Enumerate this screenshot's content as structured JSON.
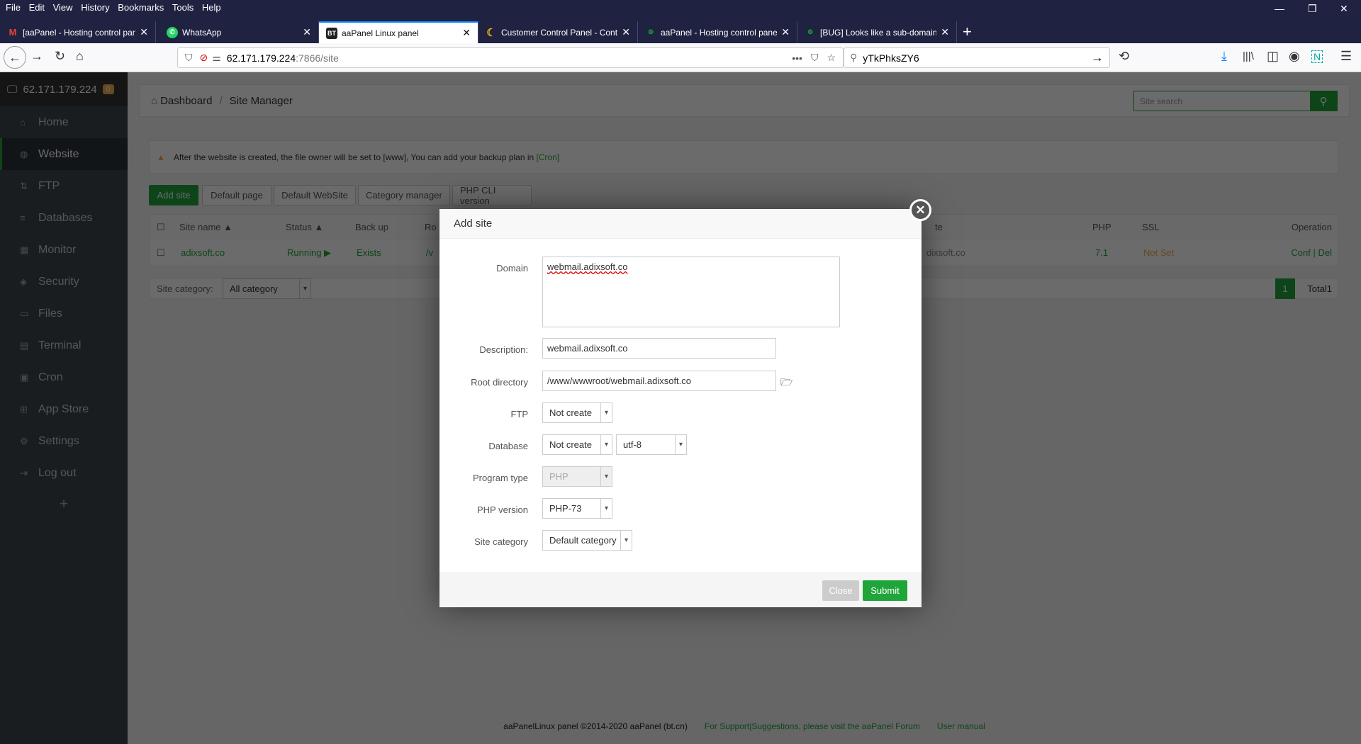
{
  "browser": {
    "menu": [
      "File",
      "Edit",
      "View",
      "History",
      "Bookmarks",
      "Tools",
      "Help"
    ],
    "tabs": [
      {
        "title": "[aaPanel - Hosting control panel",
        "icon": "gmail-icon"
      },
      {
        "title": "WhatsApp",
        "icon": "whatsapp-icon"
      },
      {
        "title": "aaPanel Linux panel",
        "icon": "bt-icon",
        "badge": "BT"
      },
      {
        "title": "Customer Control Panel - Contact",
        "icon": "moon-icon"
      },
      {
        "title": "aaPanel - Hosting control panel",
        "icon": "aapanel-icon"
      },
      {
        "title": "[BUG] Looks like a sub-domain",
        "icon": "aapanel-icon"
      }
    ],
    "url_host": "62.171.179.224",
    "url_rest": ":7866/site",
    "search_value": "yTkPhksZY6"
  },
  "sidebar": {
    "host": "62.171.179.224",
    "badge": "0",
    "items": [
      {
        "label": "Home",
        "icon": "⌂"
      },
      {
        "label": "Website",
        "icon": "◍"
      },
      {
        "label": "FTP",
        "icon": "⇅"
      },
      {
        "label": "Databases",
        "icon": "≡"
      },
      {
        "label": "Monitor",
        "icon": "▦"
      },
      {
        "label": "Security",
        "icon": "◈"
      },
      {
        "label": "Files",
        "icon": "▭"
      },
      {
        "label": "Terminal",
        "icon": "▤"
      },
      {
        "label": "Cron",
        "icon": "▣"
      },
      {
        "label": "App Store",
        "icon": "⊞"
      },
      {
        "label": "Settings",
        "icon": "⚙"
      },
      {
        "label": "Log out",
        "icon": "⇥"
      }
    ],
    "add": "+"
  },
  "breadcrumb": {
    "home": "Dashboard",
    "sep": "/",
    "current": "Site Manager"
  },
  "site_search_placeholder": "Site search",
  "notice": {
    "text": "After the website is created, the file owner will be set to [www], You can add your backup plan in ",
    "link": "[Cron]"
  },
  "toolbar": [
    "Add site",
    "Default page",
    "Default WebSite",
    "Category manager",
    "PHP CLI version"
  ],
  "table": {
    "headers": {
      "name": "Site name",
      "status": "Status",
      "backup": "Back up",
      "root": "Ro",
      "remark": "te",
      "php": "PHP",
      "ssl": "SSL",
      "op": "Operation"
    },
    "row": {
      "name": "adixsoft.co",
      "status": "Running ▶",
      "backup": "Exists",
      "root": "/v",
      "remark": "dixsoft.co",
      "php": "7.1",
      "ssl": "Not Set",
      "op": "Conf | Del"
    }
  },
  "site_category": {
    "label": "Site category:",
    "value": "All category"
  },
  "pagination": {
    "page": "1",
    "total": "Total1"
  },
  "modal": {
    "title": "Add site",
    "domain_label": "Domain",
    "domain_value": "webmail.adixsoft.co",
    "desc_label": "Description:",
    "desc_value": "webmail.adixsoft.co",
    "root_label": "Root directory",
    "root_value": "/www/wwwroot/webmail.adixsoft.co",
    "ftp_label": "FTP",
    "ftp_value": "Not create",
    "db_label": "Database",
    "db_value": "Not create",
    "charset_value": "utf-8",
    "program_label": "Program type",
    "program_value": "PHP",
    "phpver_label": "PHP version",
    "phpver_value": "PHP-73",
    "cat_label": "Site category",
    "cat_value": "Default category",
    "close": "Close",
    "submit": "Submit"
  },
  "footer": {
    "copyright": "aaPanelLinux panel ©2014-2020 aaPanel (bt.cn)",
    "support": "For Support|Suggestions, please visit the aaPanel Forum",
    "manual": "User manual"
  },
  "colors": {
    "accent": "#20a53a",
    "warning": "#f0ad4e"
  }
}
